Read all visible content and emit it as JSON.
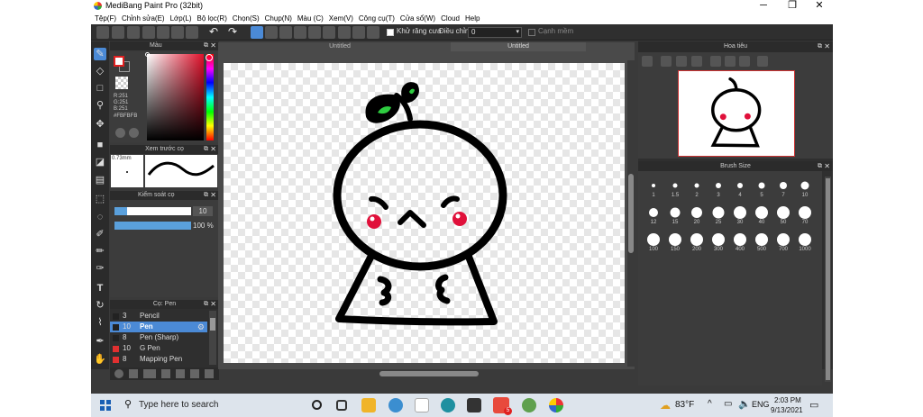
{
  "window": {
    "title": "MediBang Paint Pro (32bit)",
    "minimize": "─",
    "maximize": "❐",
    "close": "✕"
  },
  "menu": [
    "Tệp(F)",
    "Chỉnh sửa(E)",
    "Lớp(L)",
    "Bộ lọc(R)",
    "Chọn(S)",
    "Chụp(N)",
    "Màu (C)",
    "Xem(V)",
    "Công cụ(T)",
    "Cửa sổ(W)",
    "Cloud",
    "Help"
  ],
  "toolbar": {
    "antialias_label": "Khử răng cưa",
    "correction_label": "Điều chỉnh",
    "correction_value": "0",
    "edge_label": "Cạnh mềm"
  },
  "color_panel": {
    "title": "Màu",
    "r": "R:251",
    "g": "G:251",
    "b": "B:251",
    "hex": "#FBFBFB",
    "fg_color": "#e02020",
    "bg_color": "#ffffff"
  },
  "brush_preview": {
    "title": "Xem trước cọ",
    "size": "0.73mm"
  },
  "brush_control": {
    "title": "Kiểm soát cọ",
    "size_value": "10",
    "opacity_value": "100 %",
    "size_fraction": 0.17,
    "opacity_fraction": 1.0
  },
  "brush_list": {
    "title": "Cọ: Pen",
    "items": [
      {
        "num": "3",
        "name": "Pencil",
        "color": "#222222",
        "selected": false
      },
      {
        "num": "10",
        "name": "Pen",
        "color": "#222222",
        "selected": true
      },
      {
        "num": "8",
        "name": "Pen (Sharp)",
        "color": "#222222",
        "selected": false
      },
      {
        "num": "10",
        "name": "G Pen",
        "color": "#e03030",
        "selected": false
      },
      {
        "num": "8",
        "name": "Mapping Pen",
        "color": "#e03030",
        "selected": false
      }
    ]
  },
  "documents": {
    "tab1": "Untitled",
    "tab2": "Untitled"
  },
  "navigator": {
    "title": "Hoa tiêu"
  },
  "brush_size": {
    "title": "Brush Size",
    "sizes": [
      "1",
      "1.5",
      "2",
      "3",
      "4",
      "5",
      "7",
      "10",
      "12",
      "15",
      "20",
      "25",
      "30",
      "40",
      "50",
      "70",
      "100",
      "150",
      "200",
      "300",
      "400",
      "500",
      "700",
      "1000"
    ]
  },
  "taskbar": {
    "search_placeholder": "Type here to search",
    "temperature": "83°F",
    "language": "ENG",
    "time": "2:03 PM",
    "date": "9/13/2021",
    "notification_badge": "5"
  }
}
